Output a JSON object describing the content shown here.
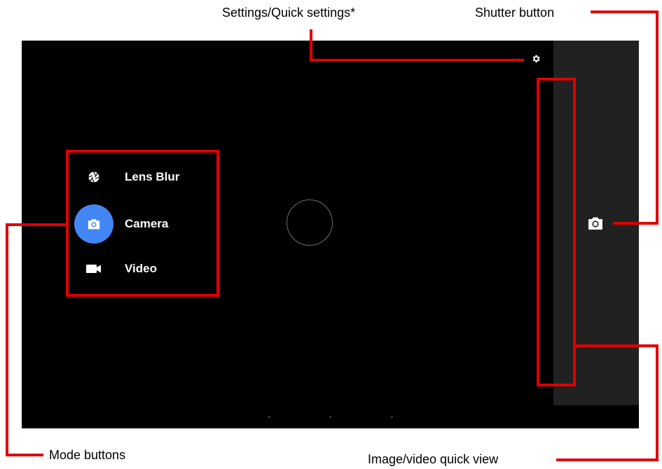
{
  "callouts": {
    "settings": "Settings/Quick settings*",
    "shutter": "Shutter button",
    "mode_buttons": "Mode buttons",
    "quick_view": "Image/video quick view"
  },
  "modes": [
    {
      "label": "Lens Blur",
      "icon": "aperture-icon",
      "active": false
    },
    {
      "label": "Camera",
      "icon": "camera-icon",
      "active": true
    },
    {
      "label": "Video",
      "icon": "videocam-icon",
      "active": false
    }
  ],
  "colors": {
    "screen_bg": "#000000",
    "panel_bg": "#212121",
    "active_mode": "#4285f4",
    "annotation_red": "#e00000"
  },
  "icons": {
    "settings": "gear-icon",
    "shutter": "camera-icon"
  }
}
